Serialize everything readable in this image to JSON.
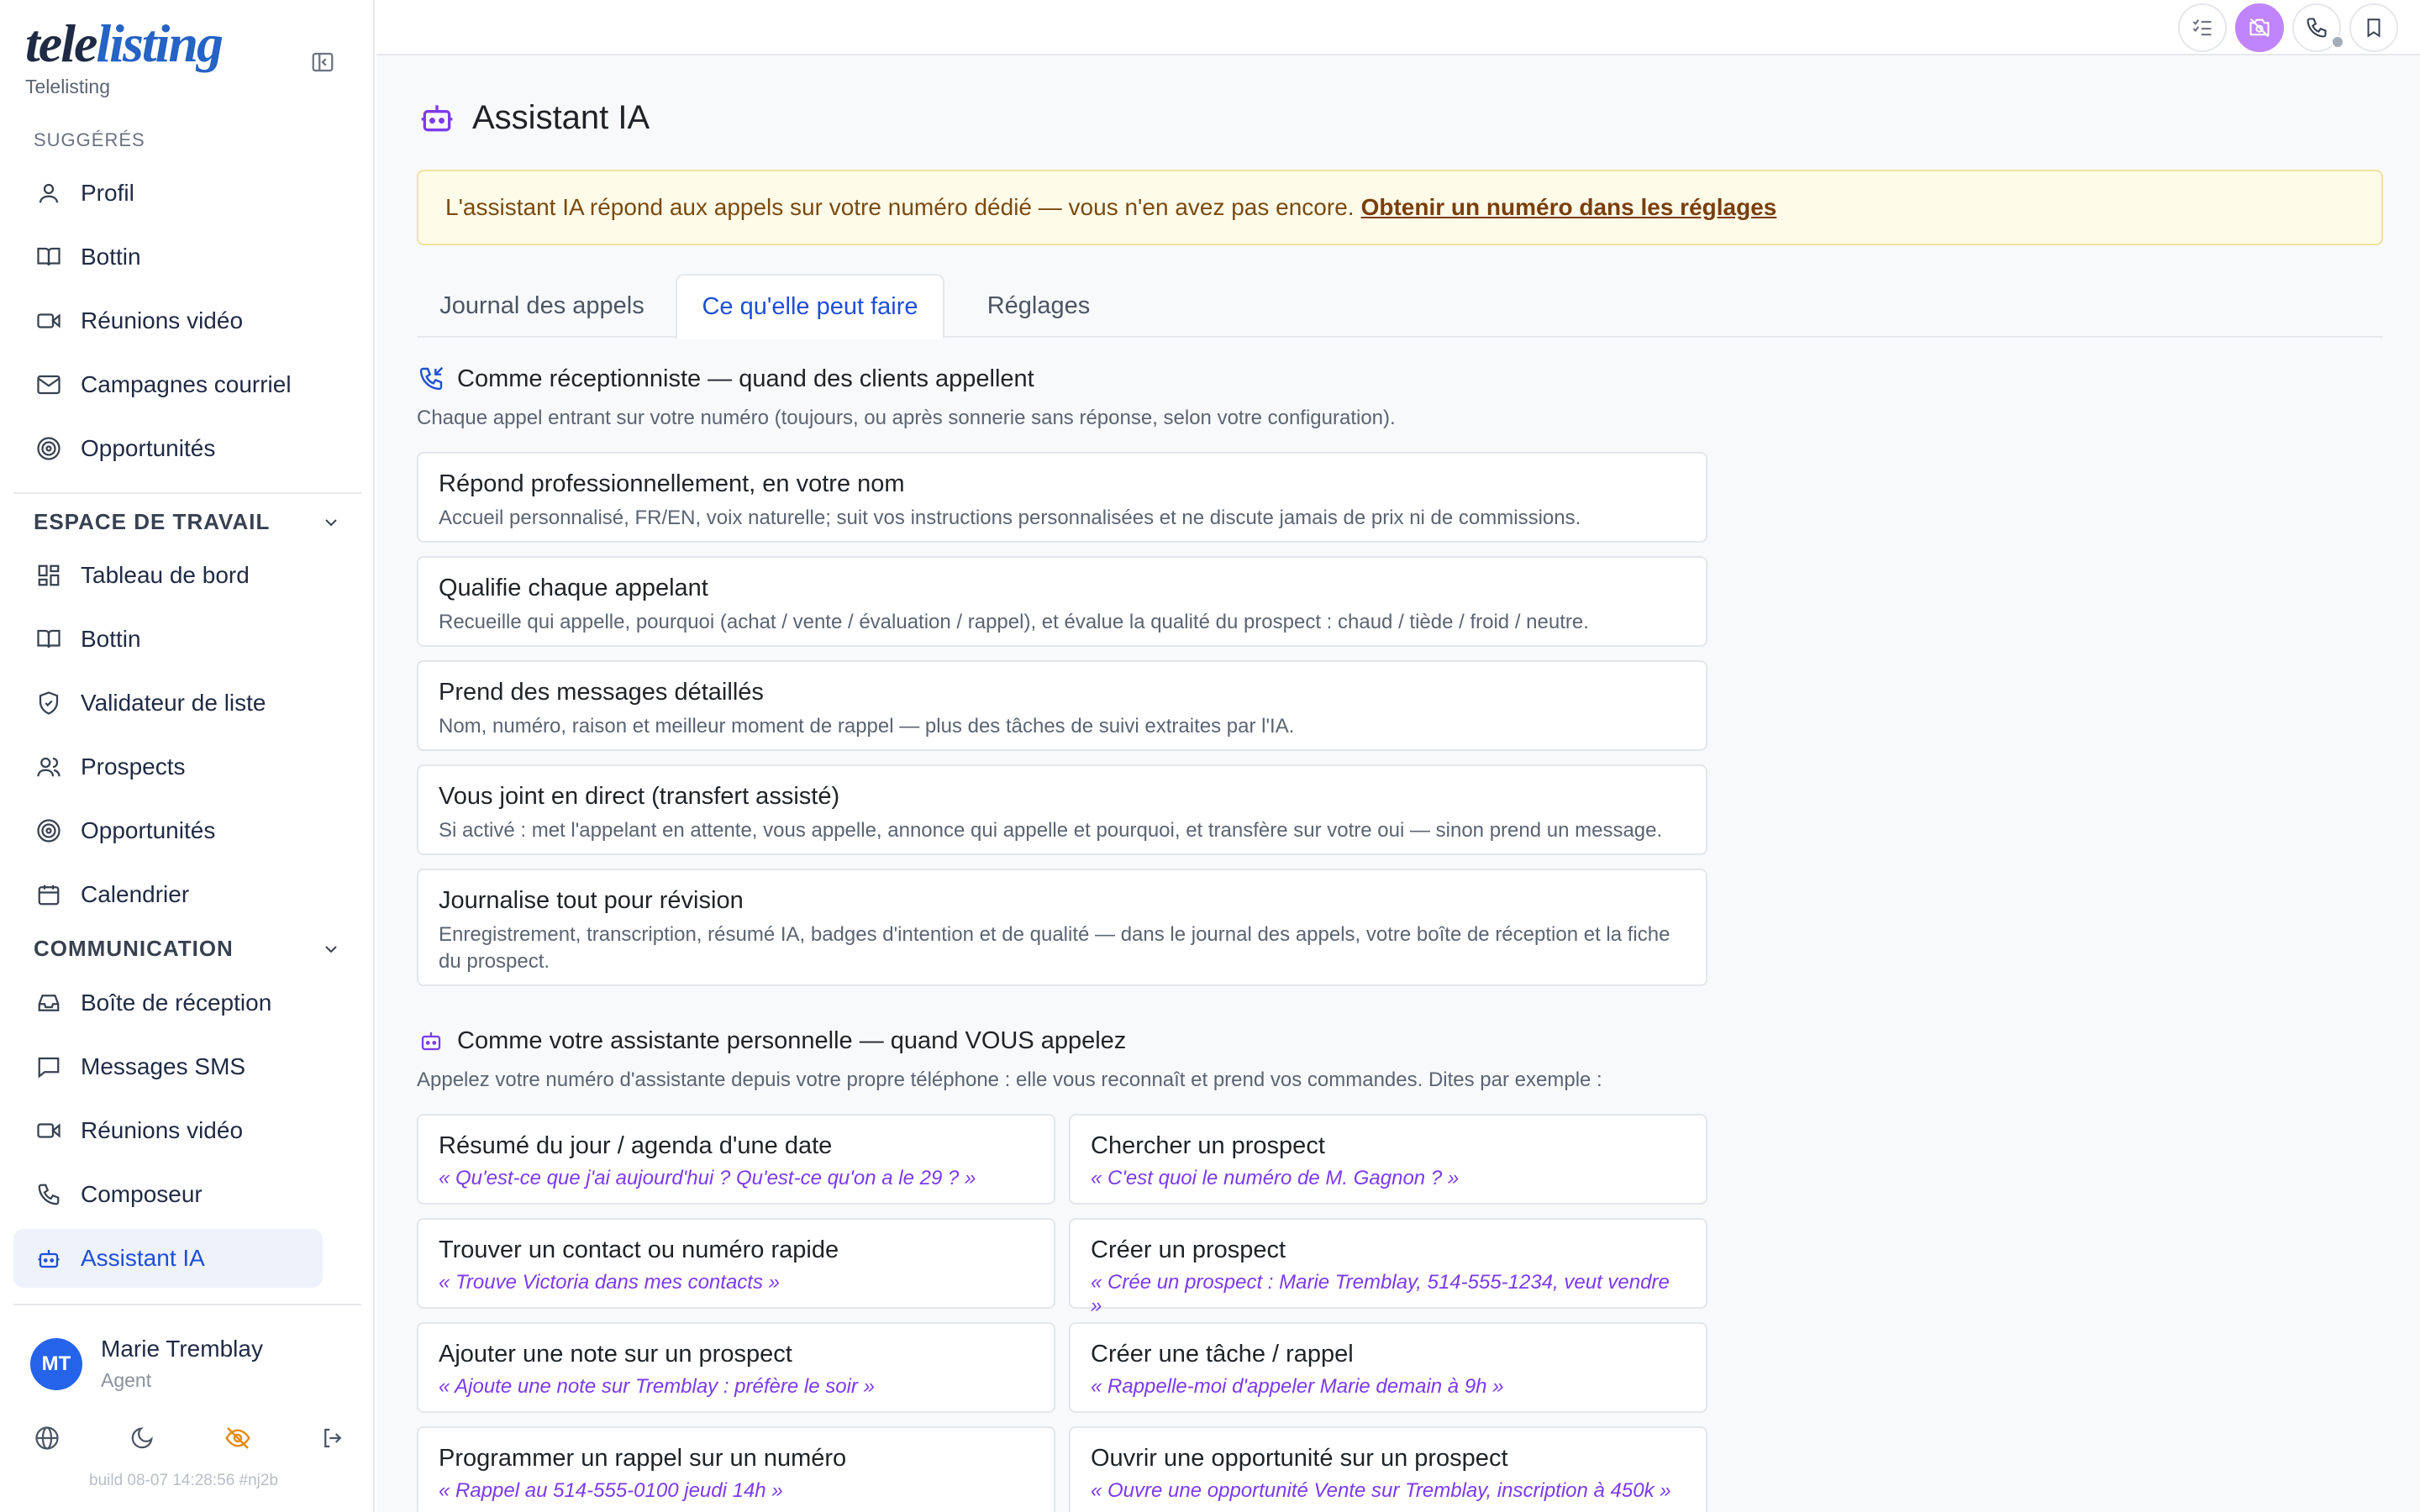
{
  "brand": {
    "logo_tele": "tele",
    "logo_listing": "listing",
    "subtitle": "Telelisting"
  },
  "sidebar": {
    "suggested_label": "SUGGÉRÉS",
    "suggested": [
      {
        "label": "Profil",
        "icon": "user-icon"
      },
      {
        "label": "Bottin",
        "icon": "book-icon"
      },
      {
        "label": "Réunions vidéo",
        "icon": "video-icon"
      },
      {
        "label": "Campagnes courriel",
        "icon": "mail-icon"
      },
      {
        "label": "Opportunités",
        "icon": "target-icon"
      }
    ],
    "workspace_label": "ESPACE DE TRAVAIL",
    "workspace": [
      {
        "label": "Tableau de bord",
        "icon": "dashboard-icon"
      },
      {
        "label": "Bottin",
        "icon": "book-icon"
      },
      {
        "label": "Validateur de liste",
        "icon": "shield-check-icon"
      },
      {
        "label": "Prospects",
        "icon": "users-icon"
      },
      {
        "label": "Opportunités",
        "icon": "target-icon"
      },
      {
        "label": "Calendrier",
        "icon": "calendar-icon"
      }
    ],
    "communication_label": "COMMUNICATION",
    "communication": [
      {
        "label": "Boîte de réception",
        "icon": "inbox-icon"
      },
      {
        "label": "Messages SMS",
        "icon": "message-icon"
      },
      {
        "label": "Réunions vidéo",
        "icon": "video-icon"
      },
      {
        "label": "Composeur",
        "icon": "phone-icon"
      },
      {
        "label": "Assistant IA",
        "icon": "bot-icon",
        "active": true
      }
    ],
    "user": {
      "initials": "MT",
      "name": "Marie Tremblay",
      "role": "Agent"
    },
    "build": "build 08-07 14:28:56 #nj2b"
  },
  "topbar": {
    "icons": [
      "checklist-icon",
      "camera-off-icon",
      "phone-icon",
      "bookmark-icon"
    ]
  },
  "page": {
    "title": "Assistant IA",
    "banner_text": "L'assistant IA répond aux appels sur votre numéro dédié — vous n'en avez pas encore.",
    "banner_link": "Obtenir un numéro dans les réglages",
    "tabs": [
      "Journal des appels",
      "Ce qu'elle peut faire",
      "Réglages"
    ],
    "active_tab": 1
  },
  "receptionist": {
    "title": "Comme réceptionniste — quand des clients appellent",
    "desc": "Chaque appel entrant sur votre numéro (toujours, ou après sonnerie sans réponse, selon votre configuration).",
    "cards": [
      {
        "title": "Répond professionnellement, en votre nom",
        "desc": "Accueil personnalisé, FR/EN, voix naturelle; suit vos instructions personnalisées et ne discute jamais de prix ni de commissions."
      },
      {
        "title": "Qualifie chaque appelant",
        "desc": "Recueille qui appelle, pourquoi (achat / vente / évaluation / rappel), et évalue la qualité du prospect : chaud / tiède / froid / neutre."
      },
      {
        "title": "Prend des messages détaillés",
        "desc": "Nom, numéro, raison et meilleur moment de rappel — plus des tâches de suivi extraites par l'IA."
      },
      {
        "title": "Vous joint en direct (transfert assisté)",
        "desc": "Si activé : met l'appelant en attente, vous appelle, annonce qui appelle et pourquoi, et transfère sur votre oui — sinon prend un message."
      },
      {
        "title": "Journalise tout pour révision",
        "desc": "Enregistrement, transcription, résumé IA, badges d'intention et de qualité — dans le journal des appels, votre boîte de réception et la fiche du prospect."
      }
    ]
  },
  "personal": {
    "title": "Comme votre assistante personnelle — quand VOUS appelez",
    "desc": "Appelez votre numéro d'assistante depuis votre propre téléphone : elle vous reconnaît et prend vos commandes. Dites par exemple :",
    "cards": [
      {
        "title": "Résumé du jour / agenda d'une date",
        "example": "« Qu'est-ce que j'ai aujourd'hui ? Qu'est-ce qu'on a le 29 ? »"
      },
      {
        "title": "Chercher un prospect",
        "example": "« C'est quoi le numéro de M. Gagnon ? »"
      },
      {
        "title": "Trouver un contact ou numéro rapide",
        "example": "« Trouve Victoria dans mes contacts »"
      },
      {
        "title": "Créer un prospect",
        "example": "« Crée un prospect : Marie Tremblay, 514-555-1234, veut vendre »"
      },
      {
        "title": "Ajouter une note sur un prospect",
        "example": "« Ajoute une note sur Tremblay : préfère le soir »"
      },
      {
        "title": "Créer une tâche / rappel",
        "example": "« Rappelle-moi d'appeler Marie demain à 9h »"
      },
      {
        "title": "Programmer un rappel sur un numéro",
        "example": "« Rappel au 514-555-0100 jeudi 14h »"
      },
      {
        "title": "Ouvrir une opportunité sur un prospect",
        "example": "« Ouvre une opportunité Vente sur Tremblay, inscription à 450k »"
      }
    ]
  },
  "colors": {
    "accent": "#1e4fd6",
    "purple": "#7c3aed",
    "banner_bg": "#fefbe8",
    "avatar": "#2563eb",
    "highlight_button": "#c084fc"
  }
}
